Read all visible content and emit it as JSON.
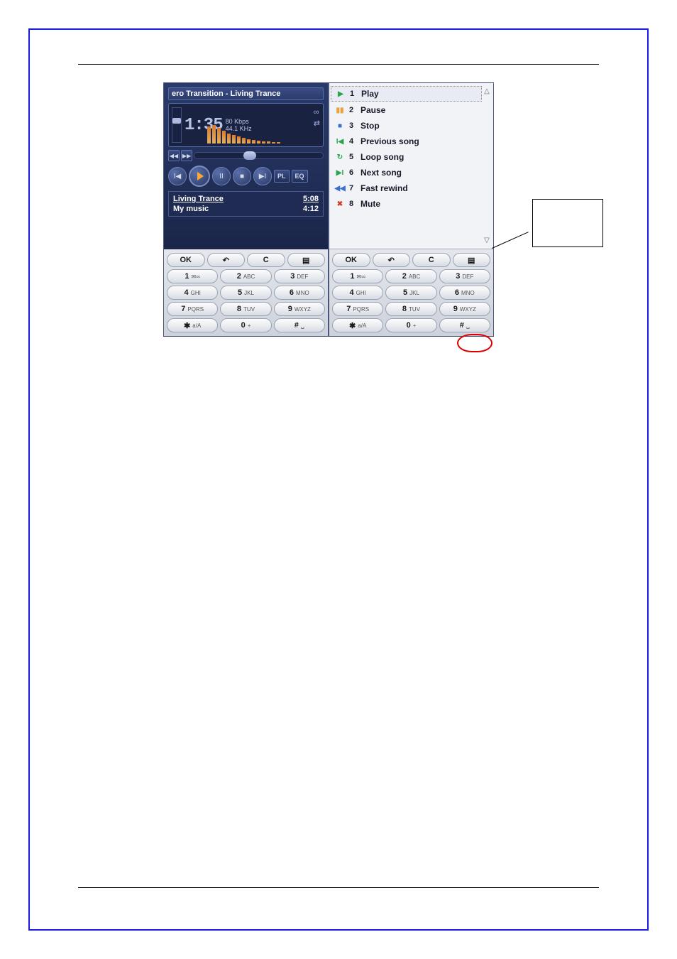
{
  "player": {
    "title": "ero Transition - Living Trance",
    "time": "1:35",
    "bitrate": "80 Kbps",
    "sample_rate": "44.1 KHz",
    "btn_pl": "PL",
    "btn_eq": "EQ",
    "playlist": [
      {
        "name": "Living Trance",
        "time": "5:08",
        "selected": true
      },
      {
        "name": "My music",
        "time": "4:12",
        "selected": false
      }
    ]
  },
  "menu": {
    "items": [
      {
        "num": "1",
        "label": "Play",
        "icon_color": "#2aa54a",
        "icon": "play",
        "selected": true
      },
      {
        "num": "2",
        "label": "Pause",
        "icon_color": "#e6a43a",
        "icon": "pause"
      },
      {
        "num": "3",
        "label": "Stop",
        "icon_color": "#3a6fd1",
        "icon": "stop"
      },
      {
        "num": "4",
        "label": "Previous song",
        "icon_color": "#2aa54a",
        "icon": "prev"
      },
      {
        "num": "5",
        "label": "Loop song",
        "icon_color": "#2aa54a",
        "icon": "loop"
      },
      {
        "num": "6",
        "label": "Next song",
        "icon_color": "#2aa54a",
        "icon": "next"
      },
      {
        "num": "7",
        "label": "Fast rewind",
        "icon_color": "#3a6fd1",
        "icon": "rewind"
      },
      {
        "num": "8",
        "label": "Mute",
        "icon_color": "#cc3a2a",
        "icon": "mute"
      }
    ]
  },
  "keypad": {
    "row0": [
      {
        "num": "OK",
        "sub": ""
      },
      {
        "num": "↶",
        "sub": ""
      },
      {
        "num": "C",
        "sub": ""
      },
      {
        "num": "▤",
        "sub": ""
      }
    ],
    "row1": [
      {
        "num": "1",
        "sub": "✉∞"
      },
      {
        "num": "2",
        "sub": "ABC"
      },
      {
        "num": "3",
        "sub": "DEF"
      }
    ],
    "row2": [
      {
        "num": "4",
        "sub": "GHI"
      },
      {
        "num": "5",
        "sub": "JKL"
      },
      {
        "num": "6",
        "sub": "MNO"
      }
    ],
    "row3": [
      {
        "num": "7",
        "sub": "PQRS"
      },
      {
        "num": "8",
        "sub": "TUV"
      },
      {
        "num": "9",
        "sub": "WXYZ"
      }
    ],
    "row4": [
      {
        "num": "✱",
        "sub": "a/A"
      },
      {
        "num": "0",
        "sub": "+"
      },
      {
        "num": "#",
        "sub": "␣"
      }
    ]
  }
}
